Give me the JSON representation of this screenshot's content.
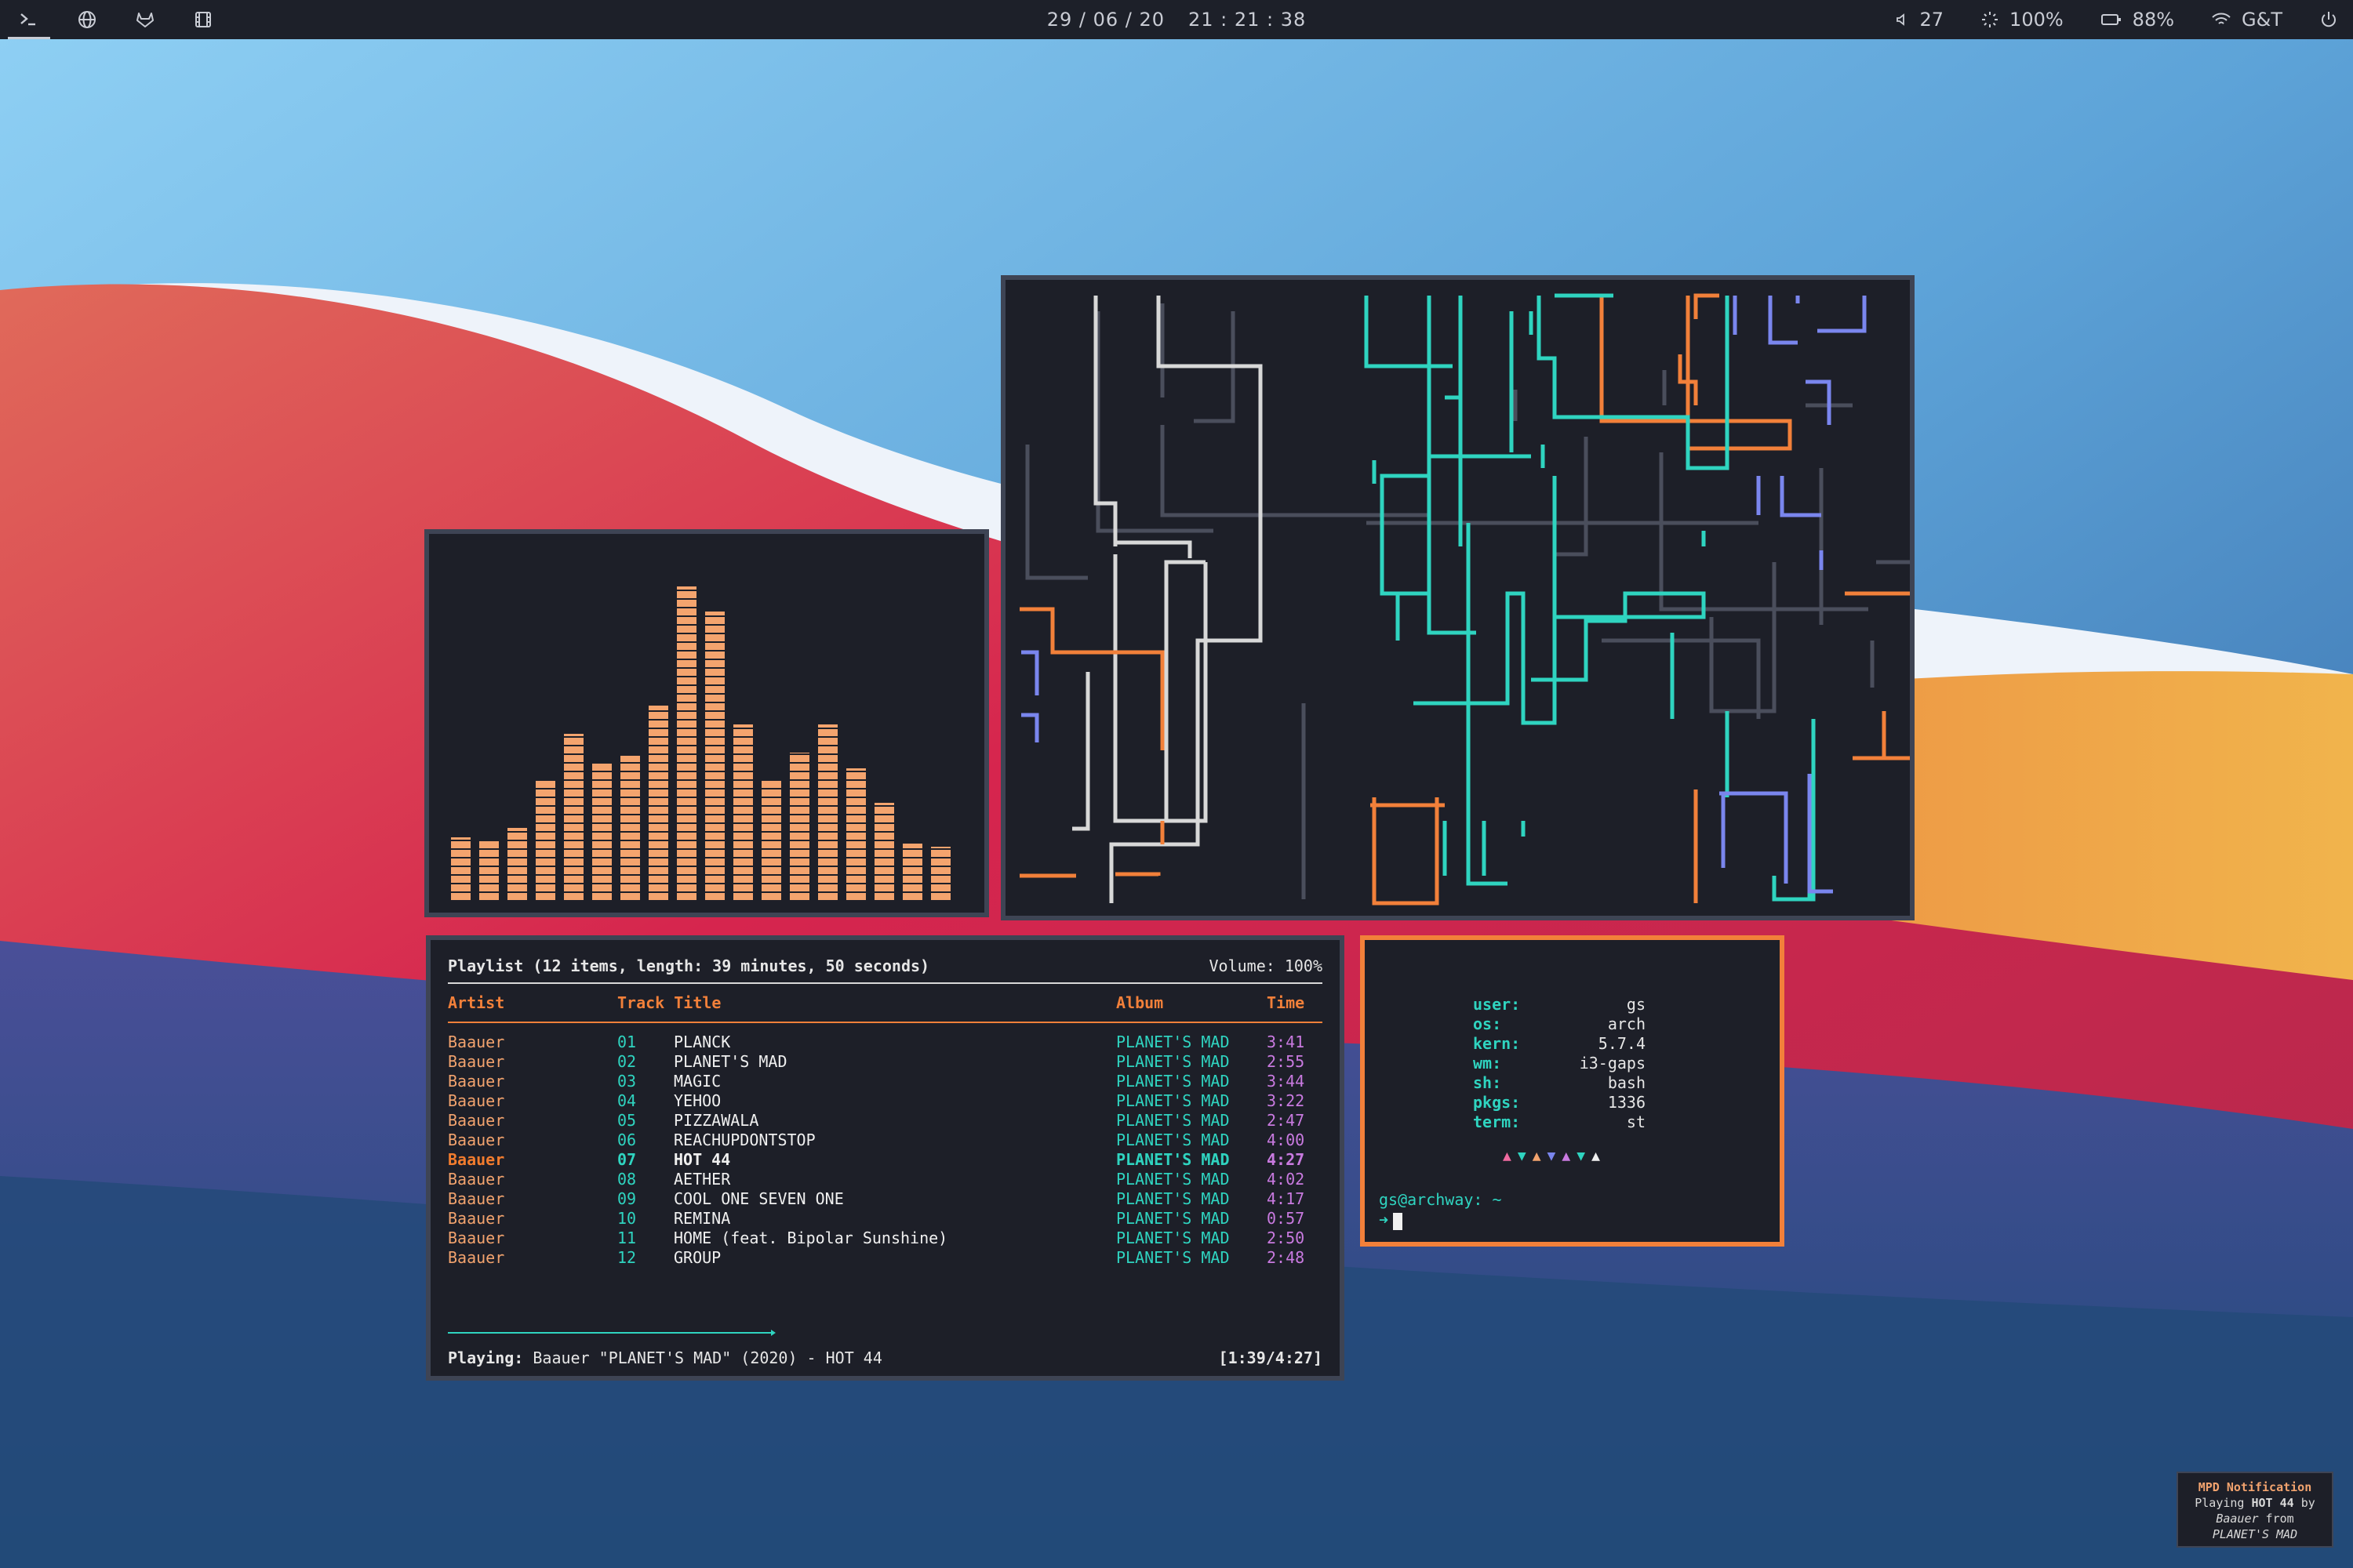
{
  "topbar": {
    "workspaces": [
      {
        "icon": "terminal-prompt-icon",
        "active": true
      },
      {
        "icon": "globe-icon",
        "active": false
      },
      {
        "icon": "gitlab-fox-icon",
        "active": false
      },
      {
        "icon": "film-icon",
        "active": false
      }
    ],
    "date": "29 / 06 / 20",
    "time": "21 : 21 : 38",
    "volume": "27",
    "brightness": "100%",
    "battery": "88%",
    "wifi": "G&T"
  },
  "visualizer": {
    "color": "#f4a46e",
    "levels": [
      0.2,
      0.19,
      0.23,
      0.38,
      0.53,
      0.44,
      0.46,
      0.62,
      1.0,
      0.92,
      0.56,
      0.38,
      0.47,
      0.56,
      0.42,
      0.31,
      0.18,
      0.17
    ]
  },
  "ncmpcpp": {
    "header": "Playlist (12 items, length: 39 minutes, 50 seconds)",
    "volume": "Volume: 100%",
    "columns": {
      "artist": "Artist",
      "track_title": "Track Title",
      "album": "Album",
      "time": "Time"
    },
    "tracks": [
      {
        "artist": "Baauer",
        "num": "01",
        "title": "PLANCK",
        "album": "PLANET'S MAD",
        "time": "3:41"
      },
      {
        "artist": "Baauer",
        "num": "02",
        "title": "PLANET'S MAD",
        "album": "PLANET'S MAD",
        "time": "2:55"
      },
      {
        "artist": "Baauer",
        "num": "03",
        "title": "MAGIC",
        "album": "PLANET'S MAD",
        "time": "3:44"
      },
      {
        "artist": "Baauer",
        "num": "04",
        "title": "YEHOO",
        "album": "PLANET'S MAD",
        "time": "3:22"
      },
      {
        "artist": "Baauer",
        "num": "05",
        "title": "PIZZAWALA",
        "album": "PLANET'S MAD",
        "time": "2:47"
      },
      {
        "artist": "Baauer",
        "num": "06",
        "title": "REACHUPDONTSTOP",
        "album": "PLANET'S MAD",
        "time": "4:00"
      },
      {
        "artist": "Baauer",
        "num": "07",
        "title": "HOT 44",
        "album": "PLANET'S MAD",
        "time": "4:27",
        "playing": true
      },
      {
        "artist": "Baauer",
        "num": "08",
        "title": "AETHER",
        "album": "PLANET'S MAD",
        "time": "4:02"
      },
      {
        "artist": "Baauer",
        "num": "09",
        "title": "COOL ONE SEVEN ONE",
        "album": "PLANET'S MAD",
        "time": "4:17"
      },
      {
        "artist": "Baauer",
        "num": "10",
        "title": "REMINA",
        "album": "PLANET'S MAD",
        "time": "0:57"
      },
      {
        "artist": "Baauer",
        "num": "11",
        "title": "HOME (feat. Bipolar Sunshine)",
        "album": "PLANET'S MAD",
        "time": "2:50"
      },
      {
        "artist": "Baauer",
        "num": "12",
        "title": "GROUP",
        "album": "PLANET'S MAD",
        "time": "2:48"
      }
    ],
    "playing_label": "Playing:",
    "playing_text": " Baauer \"PLANET'S MAD\" (2020) - HOT 44",
    "position": "[1:39/4:27]",
    "progress": 0.37
  },
  "terminal": {
    "fetch": [
      {
        "key": "user:",
        "value": "gs"
      },
      {
        "key": "os:",
        "value": "arch"
      },
      {
        "key": "kern:",
        "value": "5.7.4"
      },
      {
        "key": "wm:",
        "value": "i3-gaps"
      },
      {
        "key": "sh:",
        "value": "bash"
      },
      {
        "key": "pkgs:",
        "value": "1336"
      },
      {
        "key": "term:",
        "value": "st"
      }
    ],
    "triangles": [
      "▲",
      "▼",
      "▲",
      "▼",
      "▲",
      "▼",
      "▲"
    ],
    "triangle_colors": [
      "#f06aa0",
      "#2fd4c0",
      "#f2a36e",
      "#7a86ee",
      "#c97ae0",
      "#2fd4c0",
      "#f0f0f0"
    ],
    "prompt": "gs@archway: ~",
    "arrow": "➜"
  },
  "notification": {
    "title": "MPD Notification",
    "line1_pre": "Playing ",
    "line1_bold": "HOT 44",
    "line1_post": " by",
    "artist": "Baauer",
    "from": " from",
    "album": "PLANET'S MAD"
  },
  "colors": {
    "accent_orange": "#f2803a",
    "accent_teal": "#2fd4c0",
    "accent_purple": "#c97ae0",
    "window_bg": "#1d1f28",
    "border": "#3e4454"
  }
}
